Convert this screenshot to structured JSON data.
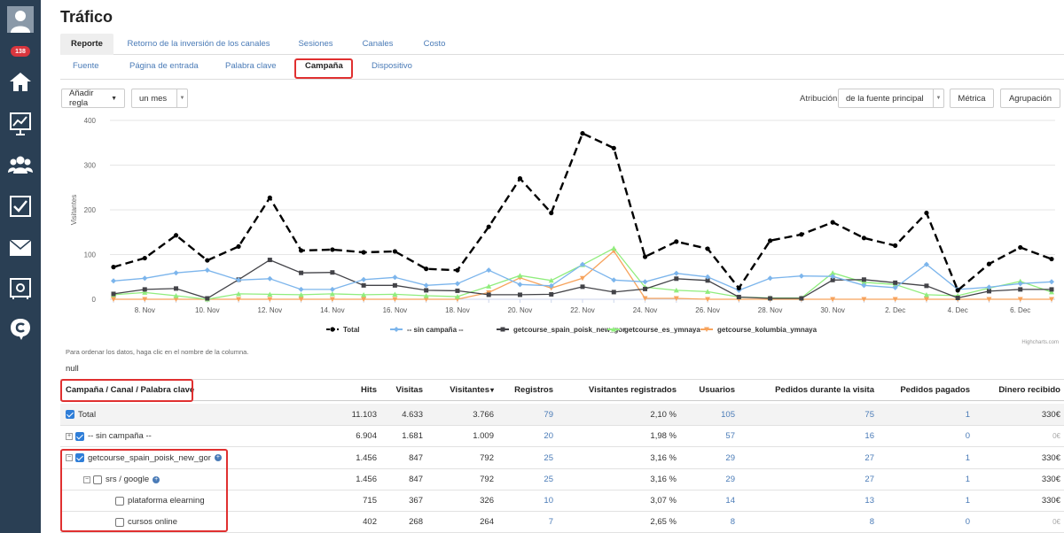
{
  "sidebar": {
    "badge": "138"
  },
  "page_title": "Tráfico",
  "tabs_primary": [
    {
      "label": "Reporte",
      "active": true
    },
    {
      "label": "Retorno de la inversión de los canales",
      "active": false
    },
    {
      "label": "Sesiones",
      "active": false
    },
    {
      "label": "Canales",
      "active": false
    },
    {
      "label": "Costo",
      "active": false
    }
  ],
  "tabs_secondary": [
    {
      "label": "Fuente",
      "active": false
    },
    {
      "label": "Página de entrada",
      "active": false
    },
    {
      "label": "Palabra clave",
      "active": false
    },
    {
      "label": "Campaña",
      "active": true
    },
    {
      "label": "Dispositivo",
      "active": false
    }
  ],
  "controls": {
    "add_rule": "Añadir regla",
    "period": "un mes",
    "attribution_label": "Atribución",
    "attribution_value": "de la fuente principal",
    "metric": "Métrica",
    "grouping": "Agrupación"
  },
  "chart_data": {
    "type": "line",
    "ylabel": "Visitantes",
    "ylim": [
      0,
      400
    ],
    "yticks": [
      "0",
      "100",
      "200",
      "300",
      "400"
    ],
    "x_labels": [
      "8. Nov",
      "10. Nov",
      "12. Nov",
      "14. Nov",
      "16. Nov",
      "18. Nov",
      "20. Nov",
      "22. Nov",
      "24. Nov",
      "26. Nov",
      "28. Nov",
      "30. Nov",
      "2. Dec",
      "4. Dec",
      "6. Dec"
    ],
    "credit": "Highcharts.com",
    "series": [
      {
        "name": "Total",
        "color": "#000000",
        "dashed": true,
        "marker": "circle",
        "values": [
          72,
          92,
          143,
          87,
          118,
          227,
          109,
          111,
          105,
          107,
          68,
          65,
          162,
          270,
          193,
          371,
          338,
          95,
          129,
          113,
          25,
          131,
          145,
          172,
          137,
          120,
          193,
          20,
          79,
          116,
          90
        ]
      },
      {
        "name": "-- sin campaña --",
        "color": "#7cb5ec",
        "dashed": false,
        "marker": "diamond",
        "values": [
          41,
          47,
          59,
          65,
          43,
          46,
          22,
          22,
          44,
          49,
          31,
          35,
          65,
          33,
          30,
          78,
          43,
          39,
          58,
          50,
          20,
          47,
          52,
          51,
          31,
          26,
          78,
          22,
          27,
          35,
          39
        ]
      },
      {
        "name": "getcourse_spain_poisk_new_gor",
        "color": "#434348",
        "dashed": false,
        "marker": "square",
        "values": [
          12,
          22,
          24,
          2,
          44,
          88,
          59,
          60,
          31,
          31,
          20,
          19,
          10,
          10,
          11,
          28,
          16,
          23,
          46,
          42,
          5,
          2,
          2,
          43,
          44,
          37,
          30,
          3,
          18,
          22,
          22
        ]
      },
      {
        "name": "getcourse_es_ymnaya",
        "color": "#90ed7d",
        "dashed": false,
        "marker": "triangle",
        "values": [
          10,
          15,
          8,
          0,
          12,
          11,
          10,
          12,
          10,
          11,
          8,
          6,
          29,
          53,
          42,
          77,
          114,
          27,
          20,
          17,
          5,
          3,
          3,
          59,
          38,
          33,
          10,
          8,
          25,
          40,
          16
        ]
      },
      {
        "name": "getcourse_kolumbia_ymnaya",
        "color": "#f7a35c",
        "dashed": false,
        "marker": "triangle-down",
        "values": [
          0,
          0,
          0,
          0,
          0,
          0,
          0,
          0,
          0,
          0,
          0,
          0,
          15,
          48,
          25,
          47,
          108,
          2,
          2,
          0,
          0,
          0,
          0,
          0,
          0,
          0,
          0,
          0,
          0,
          0,
          0
        ]
      }
    ]
  },
  "note": "Para ordenar los datos, haga clic en el nombre de la columna.",
  "null_text": "null",
  "table": {
    "columns": [
      "Campaña / Canal / Palabra clave",
      "Hits",
      "Visitas",
      "Visitantes",
      "Registros",
      "Visitantes registrados",
      "Usuarios",
      "Pedidos durante la visita",
      "Pedidos pagados",
      "Dinero recibido"
    ],
    "sort_indicator": "▾",
    "rows": [
      {
        "name": "Total",
        "hits": "11.103",
        "visits": "4.633",
        "visitors": "3.766",
        "regs": "79",
        "reg_visitors": "2,10 %",
        "users": "105",
        "orders": "75",
        "paid": "1",
        "money": "330€"
      },
      {
        "name": "-- sin campaña --",
        "hits": "6.904",
        "visits": "1.681",
        "visitors": "1.009",
        "regs": "20",
        "reg_visitors": "1,98 %",
        "users": "57",
        "orders": "16",
        "paid": "0",
        "money": "0€"
      },
      {
        "name": "getcourse_spain_poisk_new_gor",
        "hits": "1.456",
        "visits": "847",
        "visitors": "792",
        "regs": "25",
        "reg_visitors": "3,16 %",
        "users": "29",
        "orders": "27",
        "paid": "1",
        "money": "330€"
      },
      {
        "name": "srs / google",
        "hits": "1.456",
        "visits": "847",
        "visitors": "792",
        "regs": "25",
        "reg_visitors": "3,16 %",
        "users": "29",
        "orders": "27",
        "paid": "1",
        "money": "330€"
      },
      {
        "name": "plataforma elearning",
        "hits": "715",
        "visits": "367",
        "visitors": "326",
        "regs": "10",
        "reg_visitors": "3,07 %",
        "users": "14",
        "orders": "13",
        "paid": "1",
        "money": "330€"
      },
      {
        "name": "cursos online",
        "hits": "402",
        "visits": "268",
        "visitors": "264",
        "regs": "7",
        "reg_visitors": "2,65 %",
        "users": "8",
        "orders": "8",
        "paid": "0",
        "money": "0€"
      }
    ]
  }
}
